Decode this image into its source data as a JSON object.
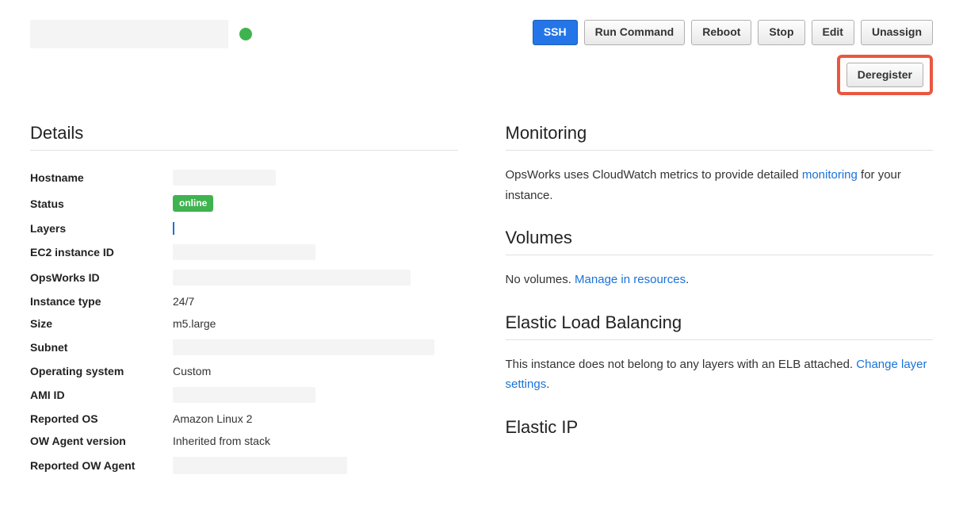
{
  "header": {
    "buttons": {
      "ssh": "SSH",
      "run_command": "Run Command",
      "reboot": "Reboot",
      "stop": "Stop",
      "edit": "Edit",
      "unassign": "Unassign",
      "deregister": "Deregister"
    }
  },
  "details": {
    "heading": "Details",
    "rows": {
      "hostname_label": "Hostname",
      "status_label": "Status",
      "status_value": "online",
      "layers_label": "Layers",
      "ec2_id_label": "EC2 instance ID",
      "opsworks_id_label": "OpsWorks ID",
      "instance_type_label": "Instance type",
      "instance_type_value": "24/7",
      "size_label": "Size",
      "size_value": "m5.large",
      "subnet_label": "Subnet",
      "os_label": "Operating system",
      "os_value": "Custom",
      "ami_id_label": "AMI ID",
      "reported_os_label": "Reported OS",
      "reported_os_value": "Amazon Linux 2",
      "ow_agent_ver_label": "OW Agent version",
      "ow_agent_ver_value": "Inherited from stack",
      "reported_ow_agent_label": "Reported OW Agent"
    }
  },
  "monitoring": {
    "heading": "Monitoring",
    "text_before": "OpsWorks uses CloudWatch metrics to provide detailed ",
    "link": "monitoring",
    "text_after": " for your instance."
  },
  "volumes": {
    "heading": "Volumes",
    "text_before": "No volumes. ",
    "link": "Manage in resources",
    "text_after": "."
  },
  "elb": {
    "heading": "Elastic Load Balancing",
    "text_before": "This instance does not belong to any layers with an ELB attached. ",
    "link": "Change layer settings",
    "text_after": "."
  },
  "eip": {
    "heading": "Elastic IP"
  }
}
